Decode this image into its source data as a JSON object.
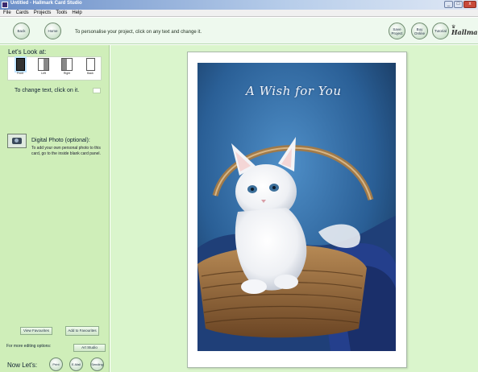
{
  "window": {
    "title": "Untitled - Hallmark Card Studio",
    "buttons": [
      "_",
      "□",
      "x"
    ]
  },
  "menu": [
    "File",
    "Cards",
    "Projects",
    "Tools",
    "Help"
  ],
  "toolbar": {
    "back_label": "Back",
    "home_label": "Home",
    "instruction": "To personalise your project, click on any text and change it.",
    "right_buttons": [
      "Save Project",
      "Buy Online",
      "Tutorial"
    ],
    "logo_text": "Hallmark"
  },
  "sidebar": {
    "lets_look_label": "Let's Look at:",
    "views": [
      {
        "label": "Front",
        "selected": true
      },
      {
        "label": "Left",
        "selected": false
      },
      {
        "label": "Right",
        "selected": false
      },
      {
        "label": "Back",
        "selected": false
      }
    ],
    "change_text_label": "To change text, click on it.",
    "photo_title": "Digital Photo (optional):",
    "photo_desc": "To add your own personal photo to this card, go to the inside blank card panel.",
    "view_favourites_label": "View Favourites",
    "add_favourites_label": "Add to Favourites",
    "more_options_label": "For more editing options:",
    "art_studio_label": "Art Studio",
    "now_lets_label": "Now Let's:",
    "actions": [
      "Print",
      "E-Mail",
      "Sending"
    ]
  },
  "card": {
    "headline": "A Wish for You"
  },
  "colors": {
    "sidebar_bg": "#cfeeb9",
    "canvas_bg": "#daf5cc",
    "toolbar_bg": "#eef9ee",
    "card_bg_blue": "#2f6ea8"
  }
}
